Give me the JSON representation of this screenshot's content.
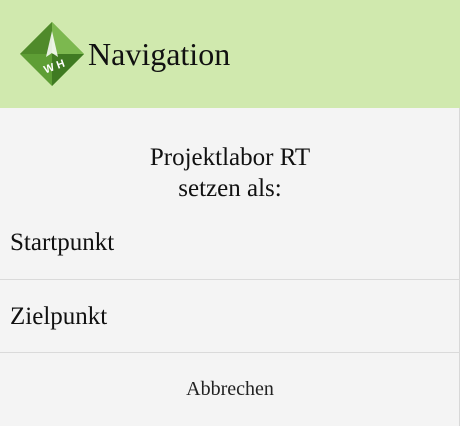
{
  "header": {
    "title": "Navigation",
    "logo_icon": "wh-diamond-logo-icon",
    "logo_text": "W H",
    "background": "#d0e9ae",
    "logo_color": "#5e9e35"
  },
  "message": {
    "line1": "Projektlabor RT",
    "line2": "setzen als:"
  },
  "options": [
    {
      "label": "Startpunkt"
    },
    {
      "label": "Zielpunkt"
    }
  ],
  "cancel_label": "Abbrechen"
}
